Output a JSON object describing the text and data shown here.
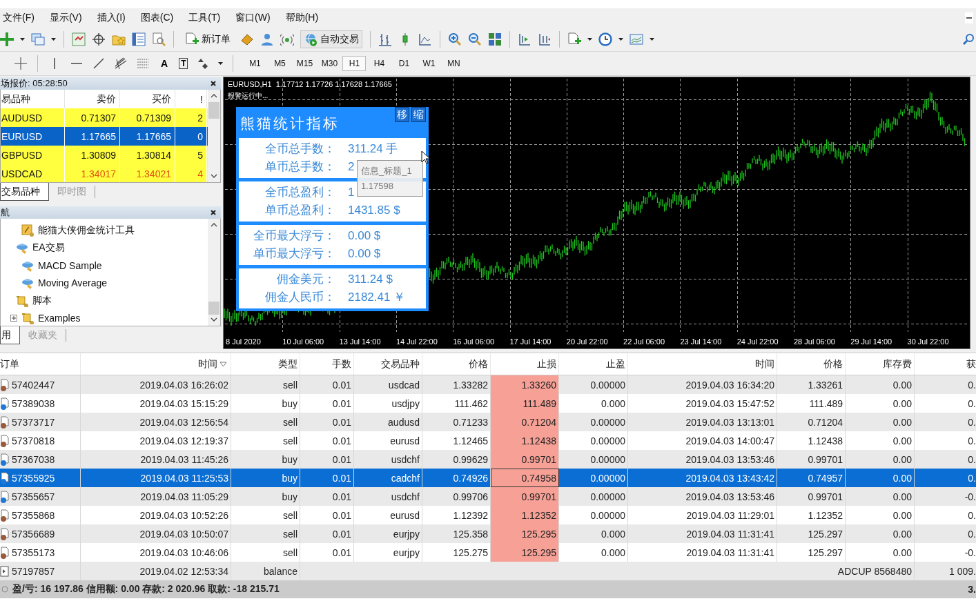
{
  "menu": [
    "文件(F)",
    "显示(V)",
    "插入(I)",
    "图表(C)",
    "工具(T)",
    "窗口(W)",
    "帮助(H)"
  ],
  "toolbar": {
    "new_order": "新订单",
    "auto_trading": "自动交易"
  },
  "drawing_tools": {
    "text_tool": "A",
    "label_tool": "T"
  },
  "timeframes": [
    {
      "label": "M1",
      "selected": false
    },
    {
      "label": "M5",
      "selected": false
    },
    {
      "label": "M15",
      "selected": false
    },
    {
      "label": "M30",
      "selected": false
    },
    {
      "label": "H1",
      "selected": true
    },
    {
      "label": "H4",
      "selected": false
    },
    {
      "label": "D1",
      "selected": false
    },
    {
      "label": "W1",
      "selected": false
    },
    {
      "label": "MN",
      "selected": false
    }
  ],
  "market_watch": {
    "title": "场报价: 05:28:50",
    "columns": [
      "易品种",
      "卖价",
      "买价",
      "!"
    ],
    "rows": [
      {
        "symbol": "AUDUSD",
        "bid": "0.71307",
        "ask": "0.71309",
        "spread": "2",
        "selected": false,
        "falling": false
      },
      {
        "symbol": "EURUSD",
        "bid": "1.17665",
        "ask": "1.17665",
        "spread": "0",
        "selected": true,
        "falling": false
      },
      {
        "symbol": "GBPUSD",
        "bid": "1.30809",
        "ask": "1.30814",
        "spread": "5",
        "selected": false,
        "falling": false
      },
      {
        "symbol": "USDCAD",
        "bid": "1.34017",
        "ask": "1.34021",
        "spread": "4",
        "selected": false,
        "falling": true
      }
    ],
    "tabs": [
      {
        "label": "交易品种",
        "selected": true
      },
      {
        "label": "即时图",
        "selected": false
      }
    ]
  },
  "navigator": {
    "title": "航",
    "tree": [
      {
        "children": [
          {
            "label": "能猫大侠佣金统计工具",
            "kind": "indicator"
          }
        ]
      },
      {
        "label": "EA交易",
        "kind": "expert",
        "expanded": true,
        "children": [
          {
            "label": "MACD Sample",
            "kind": "expert"
          },
          {
            "label": "Moving Average",
            "kind": "expert"
          }
        ]
      },
      {
        "label": "脚本",
        "kind": "script",
        "expanded": true,
        "children": [
          {
            "label": "Examples",
            "kind": "script",
            "expanded": false
          }
        ]
      }
    ],
    "tabs": [
      {
        "label": "用",
        "selected": true
      },
      {
        "label": "收藏夹",
        "selected": false
      }
    ]
  },
  "chart": {
    "header": "EURUSD,H1  1.17712 1.17726 1.17628 1.17665",
    "status": "报警运行中...",
    "x_labels": [
      "8 Jul 2020",
      "10 Jul 06:00",
      "13 Jul 14:00",
      "14 Jul 22:00",
      "16 Jul 06:00",
      "17 Jul 14:00",
      "20 Jul 22:00",
      "22 Jul 06:00",
      "23 Jul 14:00",
      "24 Jul 22:00",
      "28 Jul 06:00",
      "29 Jul 14:00",
      "30 Jul 22:00"
    ]
  },
  "stats_panel": {
    "title": "熊猫统计指标",
    "buttons": [
      "移",
      "缩"
    ],
    "sections": [
      [
        {
          "label": "全币总手数：",
          "value": "311.24 手"
        },
        {
          "label": "单币总手数：",
          "value": "2"
        }
      ],
      [
        {
          "label": "全币总盈利：",
          "value": "1"
        },
        {
          "label": "单币总盈利：",
          "value": "1431.85 $"
        }
      ],
      [
        {
          "label": "全币最大浮亏：",
          "value": "0.00 $"
        },
        {
          "label": "单币最大浮亏：",
          "value": "0.00 $"
        }
      ],
      [
        {
          "label": "佣金美元：",
          "value": "311.24 $"
        },
        {
          "label": "佣金人民币：",
          "value": "2182.41 ￥"
        }
      ]
    ]
  },
  "tooltip": {
    "title": "信息_标题_1",
    "value": "1.17598"
  },
  "orders": {
    "columns": [
      "订单",
      "时间",
      "类型",
      "手数",
      "交易品种",
      "价格",
      "止损",
      "止盈",
      "时间",
      "价格",
      "库存费",
      "获"
    ],
    "rows": [
      {
        "kind": "sell",
        "selected": false,
        "cells": [
          "57402447",
          "2019.04.03 16:26:02",
          "sell",
          "0.01",
          "usdcad",
          "1.33282",
          "1.33260",
          "0.00000",
          "2019.04.03 16:34:20",
          "1.33261",
          "0.00",
          "0."
        ]
      },
      {
        "kind": "buy",
        "selected": false,
        "cells": [
          "57389038",
          "2019.04.03 15:15:29",
          "buy",
          "0.01",
          "usdjpy",
          "111.462",
          "111.489",
          "0.000",
          "2019.04.03 15:47:52",
          "111.489",
          "0.00",
          "0."
        ]
      },
      {
        "kind": "sell",
        "selected": false,
        "cells": [
          "57373717",
          "2019.04.03 12:56:54",
          "sell",
          "0.01",
          "audusd",
          "0.71233",
          "0.71204",
          "0.00000",
          "2019.04.03 13:13:01",
          "0.71204",
          "0.00",
          "0."
        ]
      },
      {
        "kind": "sell",
        "selected": false,
        "cells": [
          "57370818",
          "2019.04.03 12:19:37",
          "sell",
          "0.01",
          "eurusd",
          "1.12465",
          "1.12438",
          "0.00000",
          "2019.04.03 14:00:47",
          "1.12438",
          "0.00",
          "0."
        ]
      },
      {
        "kind": "buy",
        "selected": false,
        "cells": [
          "57367038",
          "2019.04.03 11:45:26",
          "buy",
          "0.01",
          "usdchf",
          "0.99629",
          "0.99701",
          "0.00000",
          "2019.04.03 13:53:46",
          "0.99701",
          "0.00",
          "0."
        ]
      },
      {
        "kind": "buy",
        "selected": true,
        "cells": [
          "57355925",
          "2019.04.03 11:25:53",
          "buy",
          "0.01",
          "cadchf",
          "0.74926",
          "0.74958",
          "0.00000",
          "2019.04.03 13:43:42",
          "0.74957",
          "0.00",
          "0."
        ]
      },
      {
        "kind": "buy",
        "selected": false,
        "cells": [
          "57355657",
          "2019.04.03 11:05:29",
          "buy",
          "0.01",
          "usdchf",
          "0.99706",
          "0.99701",
          "0.00000",
          "2019.04.03 13:53:46",
          "0.99701",
          "0.00",
          "-0."
        ]
      },
      {
        "kind": "sell",
        "selected": false,
        "cells": [
          "57355868",
          "2019.04.03 10:52:26",
          "sell",
          "0.01",
          "eurusd",
          "1.12392",
          "1.12352",
          "0.00000",
          "2019.04.03 11:29:01",
          "1.12352",
          "0.00",
          "0."
        ]
      },
      {
        "kind": "sell",
        "selected": false,
        "cells": [
          "57356689",
          "2019.04.03 10:50:07",
          "sell",
          "0.01",
          "eurjpy",
          "125.358",
          "125.295",
          "0.000",
          "2019.04.03 11:31:41",
          "125.297",
          "0.00",
          "0."
        ]
      },
      {
        "kind": "sell",
        "selected": false,
        "cells": [
          "57355173",
          "2019.04.03 10:46:06",
          "sell",
          "0.01",
          "eurjpy",
          "125.275",
          "125.295",
          "0.000",
          "2019.04.03 11:31:41",
          "125.297",
          "0.00",
          "-0."
        ]
      },
      {
        "kind": "balance",
        "selected": false,
        "cells": [
          "57197857",
          "2019.04.02 12:53:34",
          "balance"
        ],
        "comment": "ADCUP 8568480",
        "profit": "1 009."
      }
    ],
    "summary": "盈/亏: 16 197.86  信用额: 0.00  存款: 2 020.96  取款: -18 215.71",
    "total": "3."
  }
}
